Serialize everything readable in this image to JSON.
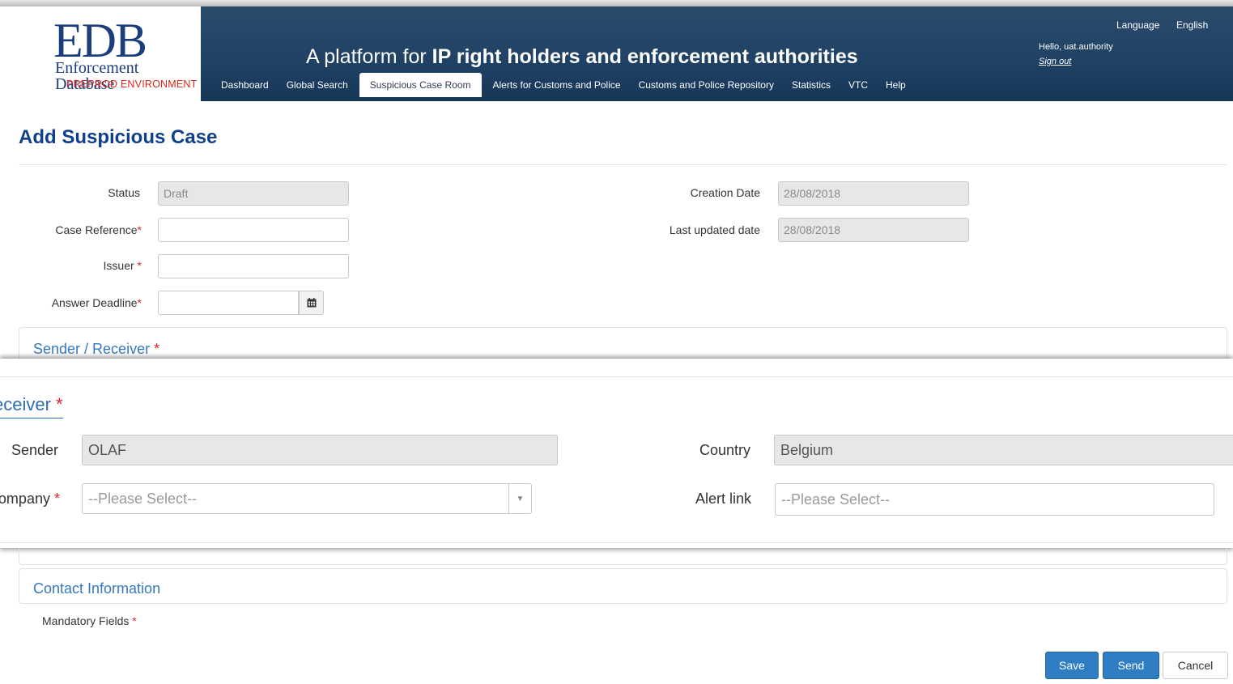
{
  "header": {
    "logo_title": "EDB",
    "logo_subtitle_line1": "Enforcement",
    "logo_subtitle_line2": "Database",
    "environment_badge": "PREPROD ENVIRONMENT",
    "tagline_prefix": "A platform for ",
    "tagline_bold": "IP right holders and enforcement authorities",
    "language_label": "Language",
    "language_value": "English",
    "greeting": "Hello, uat.authority",
    "signout": "Sign out"
  },
  "nav": {
    "items": [
      {
        "label": "Dashboard"
      },
      {
        "label": "Global Search"
      },
      {
        "label": "Suspicious Case Room",
        "active": true
      },
      {
        "label": "Alerts for Customs and Police"
      },
      {
        "label": "Customs and Police Repository"
      },
      {
        "label": "Statistics"
      },
      {
        "label": "VTC"
      },
      {
        "label": "Help"
      }
    ]
  },
  "page": {
    "title": "Add Suspicious Case"
  },
  "form": {
    "status_label": "Status",
    "status_value": "Draft",
    "case_reference_label": "Case Reference",
    "case_reference_value": "",
    "issuer_label": "Issuer",
    "issuer_value": "",
    "answer_deadline_label": "Answer Deadline",
    "answer_deadline_value": "",
    "calendar_icon": "calendar-icon",
    "creation_date_label": "Creation Date",
    "creation_date_value": "28/08/2018",
    "last_updated_label": "Last updated date",
    "last_updated_value": "28/08/2018",
    "required_mark": "*"
  },
  "sender_receiver": {
    "title": "Sender / Receiver",
    "zoom_title": "eceiver",
    "sender_label": "Sender",
    "sender_value": "OLAF",
    "country_label": "Country",
    "country_value": "Belgium",
    "company_label": "ompany",
    "company_placeholder": "--Please Select--",
    "alert_link_label": "Alert link",
    "alert_link_placeholder": "--Please Select--"
  },
  "contact": {
    "title": "Contact Information"
  },
  "footer": {
    "mandatory_label": "Mandatory Fields",
    "save_label": "Save",
    "send_label": "Send",
    "cancel_label": "Cancel"
  },
  "colors": {
    "header_bg": "#1f4265",
    "title_blue": "#103f8c",
    "link_blue": "#3578bd",
    "required_red": "#d9262c",
    "primary_button": "#2f7dc3"
  }
}
